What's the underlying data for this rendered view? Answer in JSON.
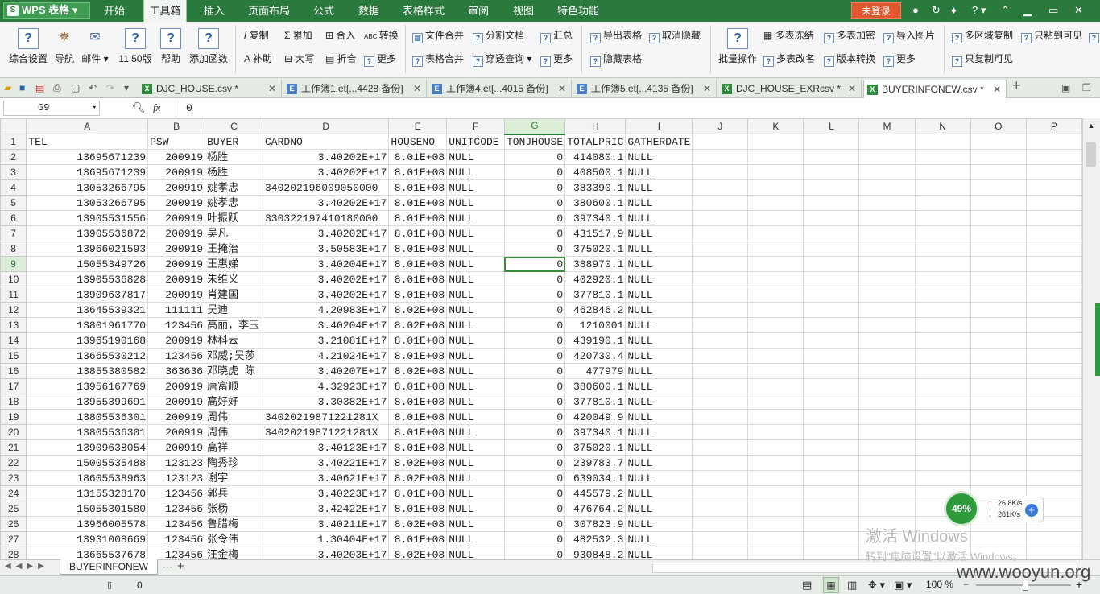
{
  "app": {
    "logo": "WPS 表格",
    "login": "未登录"
  },
  "menus": [
    "开始",
    "工具箱",
    "插入",
    "页面布局",
    "公式",
    "数据",
    "表格样式",
    "审阅",
    "视图",
    "特色功能"
  ],
  "ribbon": {
    "big": [
      "综合设置",
      "导航",
      "邮件",
      "11.50版",
      "帮助",
      "添加函数",
      "批量操作"
    ],
    "small": [
      "复制",
      "累加",
      "合入",
      "转换",
      "补助",
      "大写",
      "折合",
      "更多",
      "文件合并",
      "分割文档",
      "汇总",
      "表格合并",
      "穿透查询",
      "更多",
      "导出表格",
      "取消隐藏",
      "隐藏表格",
      "多表冻结",
      "多表加密",
      "导入图片",
      "多表改名",
      "版本转换",
      "更多",
      "多区域复制",
      "只粘到可见",
      "只复制可见"
    ]
  },
  "doctabs": [
    "DJC_HOUSE.csv *",
    "工作簿1.et[...4428 备份]",
    "工作簿4.et[...4015 备份]",
    "工作簿5.et[...4135 备份]",
    "DJC_HOUSE_EXRcsv *",
    "BUYERINFONEW.csv *"
  ],
  "formula": {
    "cell": "G9",
    "fx": "fx",
    "value": "0"
  },
  "columns": [
    "A",
    "B",
    "C",
    "D",
    "E",
    "F",
    "G",
    "H",
    "I",
    "J",
    "K",
    "L",
    "M",
    "N",
    "O",
    "P"
  ],
  "rows": [
    [
      "1",
      "TEL",
      "PSW",
      "BUYER",
      "CARDNO",
      "HOUSENO",
      "UNITCODE",
      "TONJHOUSE",
      "TOTALPRIC",
      "GATHERDATE"
    ],
    [
      "2",
      "13695671239",
      "200919",
      "杨胜",
      "3.40202E+17",
      "8.01E+08",
      "NULL",
      "0",
      "414080.1",
      "NULL"
    ],
    [
      "3",
      "13695671239",
      "200919",
      "杨胜",
      "3.40202E+17",
      "8.01E+08",
      "NULL",
      "0",
      "408500.1",
      "NULL"
    ],
    [
      "4",
      "13053266795",
      "200919",
      "姚孝忠",
      "340202196009050000",
      "8.01E+08",
      "NULL",
      "0",
      "383390.1",
      "NULL"
    ],
    [
      "5",
      "13053266795",
      "200919",
      "姚孝忠",
      "3.40202E+17",
      "8.01E+08",
      "NULL",
      "0",
      "380600.1",
      "NULL"
    ],
    [
      "6",
      "13905531556",
      "200919",
      "叶振跃",
      "330322197410180000",
      "8.01E+08",
      "NULL",
      "0",
      "397340.1",
      "NULL"
    ],
    [
      "7",
      "13905536872",
      "200919",
      "吴凡",
      "3.40202E+17",
      "8.01E+08",
      "NULL",
      "0",
      "431517.9",
      "NULL"
    ],
    [
      "8",
      "13966021593",
      "200919",
      "王掩治",
      "3.50583E+17",
      "8.01E+08",
      "NULL",
      "0",
      "375020.1",
      "NULL"
    ],
    [
      "9",
      "15055349726",
      "200919",
      "王惠娣",
      "3.40204E+17",
      "8.01E+08",
      "NULL",
      "0",
      "388970.1",
      "NULL"
    ],
    [
      "10",
      "13905536828",
      "200919",
      "朱维义",
      "3.40202E+17",
      "8.01E+08",
      "NULL",
      "0",
      "402920.1",
      "NULL"
    ],
    [
      "11",
      "13909637817",
      "200919",
      "肖建国",
      "3.40202E+17",
      "8.01E+08",
      "NULL",
      "0",
      "377810.1",
      "NULL"
    ],
    [
      "12",
      "13645539321",
      "111111",
      "吴迪",
      "4.20983E+17",
      "8.02E+08",
      "NULL",
      "0",
      "462846.2",
      "NULL"
    ],
    [
      "13",
      "13801961770",
      "123456",
      "高丽，李玉",
      "3.40204E+17",
      "8.02E+08",
      "NULL",
      "0",
      "1210001",
      "NULL"
    ],
    [
      "14",
      "13965190168",
      "200919",
      "林科云",
      "3.21081E+17",
      "8.01E+08",
      "NULL",
      "0",
      "439190.1",
      "NULL"
    ],
    [
      "15",
      "13665530212",
      "123456",
      "邓威;吴莎",
      "4.21024E+17",
      "8.01E+08",
      "NULL",
      "0",
      "420730.4",
      "NULL"
    ],
    [
      "16",
      "13855380582",
      "363636",
      "邓晓虎 陈",
      "3.40207E+17",
      "8.02E+08",
      "NULL",
      "0",
      "477979",
      "NULL"
    ],
    [
      "17",
      "13956167769",
      "200919",
      "唐富顺",
      "4.32923E+17",
      "8.01E+08",
      "NULL",
      "0",
      "380600.1",
      "NULL"
    ],
    [
      "18",
      "13955399691",
      "200919",
      "高好好",
      "3.30382E+17",
      "8.01E+08",
      "NULL",
      "0",
      "377810.1",
      "NULL"
    ],
    [
      "19",
      "13805536301",
      "200919",
      "周伟",
      "34020219871221281X",
      "8.01E+08",
      "NULL",
      "0",
      "420049.9",
      "NULL"
    ],
    [
      "20",
      "13805536301",
      "200919",
      "周伟",
      "34020219871221281X",
      "8.01E+08",
      "NULL",
      "0",
      "397340.1",
      "NULL"
    ],
    [
      "21",
      "13909638054",
      "200919",
      "高祥",
      "3.40123E+17",
      "8.01E+08",
      "NULL",
      "0",
      "375020.1",
      "NULL"
    ],
    [
      "22",
      "15005535488",
      "123123",
      "陶秀珍",
      "3.40221E+17",
      "8.02E+08",
      "NULL",
      "0",
      "239783.7",
      "NULL"
    ],
    [
      "23",
      "18605538963",
      "123123",
      "谢宇",
      "3.40621E+17",
      "8.02E+08",
      "NULL",
      "0",
      "639034.1",
      "NULL"
    ],
    [
      "24",
      "13155328170",
      "123456",
      "郭兵",
      "3.40223E+17",
      "8.01E+08",
      "NULL",
      "0",
      "445579.2",
      "NULL"
    ],
    [
      "25",
      "15055301580",
      "123456",
      "张杨",
      "3.42422E+17",
      "8.01E+08",
      "NULL",
      "0",
      "476764.2",
      "NULL"
    ],
    [
      "26",
      "13966005578",
      "123456",
      "鲁腊梅",
      "3.40211E+17",
      "8.02E+08",
      "NULL",
      "0",
      "307823.9",
      "NULL"
    ],
    [
      "27",
      "13931008669",
      "123456",
      "张令伟",
      "1.30404E+17",
      "8.01E+08",
      "NULL",
      "0",
      "482532.3",
      "NULL"
    ],
    [
      "28",
      "13665537678",
      "123456",
      "汪金梅",
      "3.40203E+17",
      "8.02E+08",
      "NULL",
      "0",
      "930848.2",
      "NULL"
    ]
  ],
  "selected": {
    "row": 9,
    "col": "G"
  },
  "sheet_tab": "BUYERINFONEW",
  "status": {
    "count": "0",
    "zoom": "100 %"
  },
  "net": {
    "percent": "49%",
    "up": "26.8K/s",
    "down": "281K/s"
  },
  "watermark": {
    "line1": "激活 Windows",
    "line2": "转到\"电脑设置\"以激活 Windows。"
  },
  "site": "www.wooyun.org"
}
